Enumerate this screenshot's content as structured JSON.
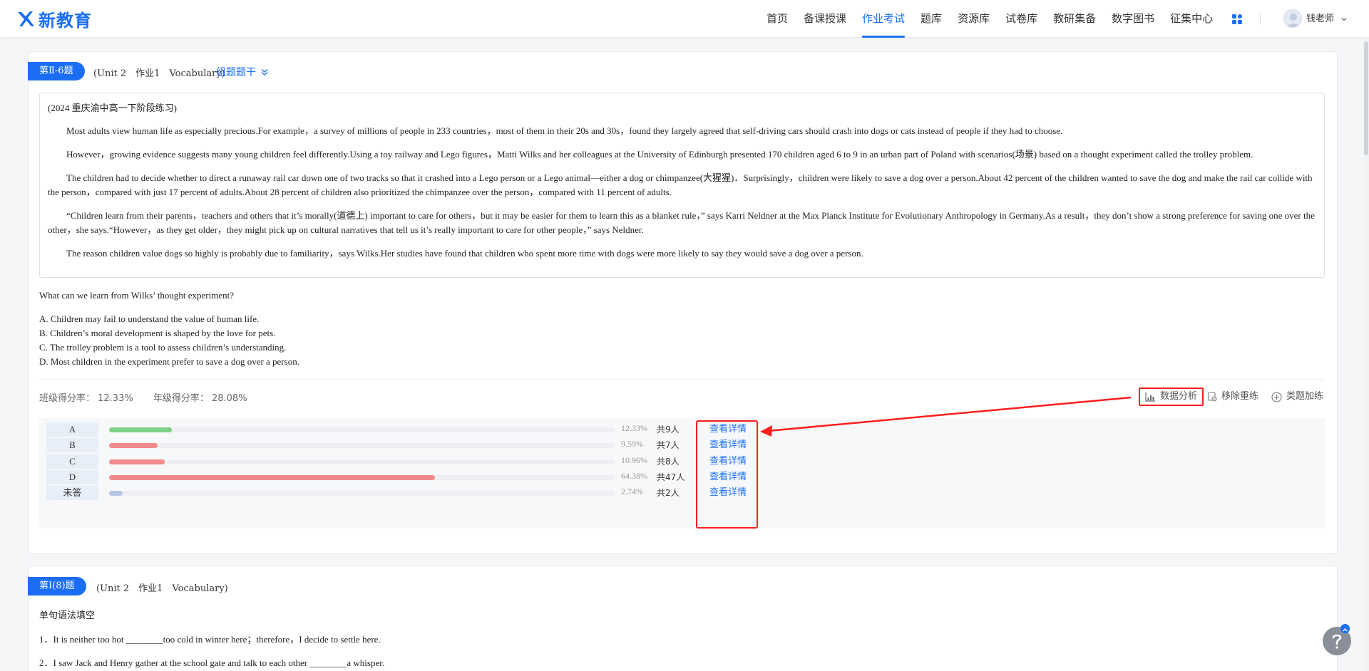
{
  "header": {
    "logo_text": "新教育",
    "nav": [
      {
        "label": "首页",
        "active": false
      },
      {
        "label": "备课授课",
        "active": false
      },
      {
        "label": "作业考试",
        "active": true
      },
      {
        "label": "题库",
        "active": false
      },
      {
        "label": "资源库",
        "active": false
      },
      {
        "label": "试卷库",
        "active": false
      },
      {
        "label": "教研集备",
        "active": false
      },
      {
        "label": "数字图书",
        "active": false
      },
      {
        "label": "征集中心",
        "active": false
      }
    ],
    "user_name": "钱老师",
    "accent_color": "#1b6ef3"
  },
  "question1": {
    "tag": "第Ⅱ-6题",
    "meta": "(Unit 2　作业1　Vocabulary)",
    "group_stem": "组题题干",
    "source": "(2024 重庆渝中高一下阶段练习)",
    "paragraphs": [
      "Most adults view human life as especially precious.For example，a survey of millions of people in 233 countries，most of them in their 20s and 30s，found they largely agreed that self-driving cars should crash into dogs or cats instead of people if they had to choose.",
      "However，growing evidence suggests many young children feel differently.Using a toy railway and Lego figures，Matti Wilks and her colleagues at the University of Edinburgh presented 170 children aged 6 to 9 in an urban part of Poland with scenarios(场景) based on a thought experiment called the trolley problem.",
      "The children had to decide whether to direct a runaway rail car down one of two tracks so that it crashed into a Lego person or a Lego animal—either a dog or chimpanzee(大猩猩)．Surprisingly，children were likely to save a dog over a person.About 42 percent of the children wanted to save the dog and make the rail car collide with the person，compared with just 17 percent of adults.About 28 percent of children also prioritized the chimpanzee over the person，compared with 11 percent of adults.",
      "“Children learn from their parents，teachers and others that it’s morally(道德上) important to care for others，but it may be easier for them to learn this as a blanket rule，” says Karri Neldner at the Max Planck Institute for Evolutionary Anthropology in Germany.As a result，they don’t show a strong preference for saving one over the other，she says.“However，as they get older，they might pick up on cultural narratives that tell us it’s really important to care for other people，” says Neldner.",
      "The reason children value dogs so highly is probably due to familiarity，says Wilks.Her studies have found that children who spent more time with dogs were more likely to say they would save a dog over a person."
    ],
    "question": "What can we learn from Wilks’ thought experiment?",
    "options": [
      "A. Children may fail to understand the value of human life.",
      "B. Children’s moral development is shaped by the love for pets.",
      "C. The trolley problem is a tool to assess children’s understanding.",
      "D. Most children in the experiment prefer to save a dog over a person."
    ],
    "class_rate": "班级得分率： 12.33%",
    "grade_rate": "年级得分率： 28.08%",
    "tools": {
      "analyze": "数据分析",
      "remove": "移除重练",
      "similar": "类题加练"
    },
    "stats": [
      {
        "label": "A",
        "percent": 12.33,
        "percent_text": "12.33%",
        "count": "共9人",
        "detail": "查看详情",
        "color": "#7ed087"
      },
      {
        "label": "B",
        "percent": 9.59,
        "percent_text": "9.59%",
        "count": "共7人",
        "detail": "查看详情",
        "color": "#f28b8b"
      },
      {
        "label": "C",
        "percent": 10.96,
        "percent_text": "10.96%",
        "count": "共8人",
        "detail": "查看详情",
        "color": "#f28b8b"
      },
      {
        "label": "D",
        "percent": 64.38,
        "percent_text": "64.38%",
        "count": "共47人",
        "detail": "查看详情",
        "color": "#f28b8b"
      },
      {
        "label": "未答",
        "percent": 2.74,
        "percent_text": "2.74%",
        "count": "共2人",
        "detail": "查看详情",
        "color": "#b6c6e2"
      }
    ]
  },
  "question2": {
    "tag": "第Ⅰ(8)题",
    "meta": "(Unit 2　作业1　Vocabulary)",
    "title": "单句语法填空",
    "items": [
      "1．It is neither too hot ________too cold in winter here；therefore，I decide to settle here.",
      "2．I saw Jack and Henry gather at the school gate and talk to each other ________a whisper."
    ]
  }
}
